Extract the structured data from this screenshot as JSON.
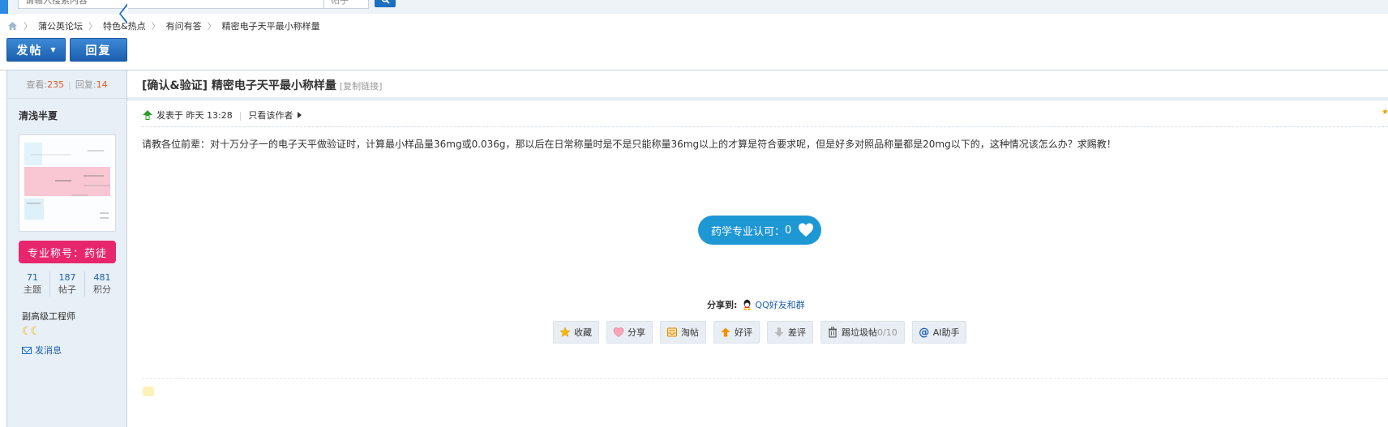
{
  "search": {
    "placeholder": "请输入搜索内容",
    "type_label": "帖子"
  },
  "breadcrumb": {
    "items": [
      "蒲公英论坛",
      "特色&热点",
      "有问有答",
      "精密电子天平最小称样量"
    ]
  },
  "toolbar": {
    "post_label": "发帖",
    "reply_label": "回复"
  },
  "thread_stats": {
    "views_label": "查看:",
    "views": "235",
    "replies_label": "回复:",
    "replies": "14"
  },
  "author": {
    "name": "清浅半夏",
    "rank_badge": "专业称号：药徒",
    "stats": [
      {
        "value": "71",
        "label": "主题"
      },
      {
        "value": "187",
        "label": "帖子"
      },
      {
        "value": "481",
        "label": "积分"
      }
    ],
    "title": "副高级工程师",
    "level_icons": "☾☾",
    "send_message": "发消息"
  },
  "post": {
    "title": "[确认&验证] 精密电子天平最小称样量",
    "copy_link": "[复制链接]",
    "posted_label": "发表于 昨天 13:28",
    "only_author": "只看该作者",
    "body": "请教各位前辈：对十万分子一的电子天平做验证时，计算最小样品量36mg或0.036g，那以后在日常称量时是不是只能称量36mg以上的才算是符合要求呢，但是好多对照品称量都是20mg以下的，这种情况该怎么办？求赐教！",
    "endorse_label": "药学专业认可：",
    "endorse_count": "0"
  },
  "share": {
    "label": "分享到:",
    "qq": "QQ好友和群"
  },
  "actions": {
    "favorite": "收藏",
    "share": "分享",
    "tao": "淘帖",
    "like": "好评",
    "dislike": "差评",
    "trash": "踢垃圾帖",
    "trash_count": "0/10",
    "ai": "AI助手"
  },
  "colors": {
    "brand_blue": "#1b6fbf",
    "badge_pink": "#e8266e",
    "endorse_blue": "#1e97d5",
    "count_orange": "#e15824"
  }
}
